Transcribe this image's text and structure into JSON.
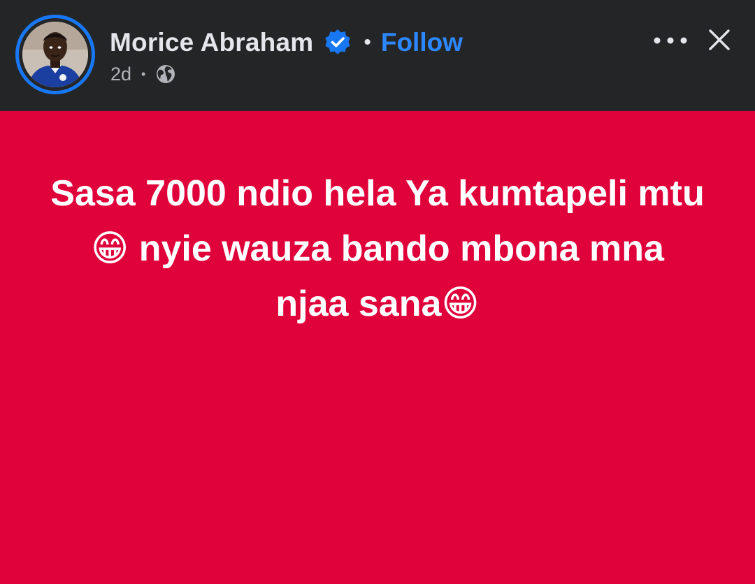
{
  "header": {
    "author_name": "Morice Abraham",
    "separator": "•",
    "follow_label": "Follow",
    "timestamp": "2d",
    "meta_separator": "•",
    "audience_icon": "globe-icon",
    "verified_icon": "verified-badge-icon",
    "more_icon": "more-options-icon",
    "close_icon": "close-icon"
  },
  "post": {
    "line1": "Sasa 7000 ndio hela Ya kumtapeli mtu",
    "line2": "😁 nyie wauza bando mbona mna",
    "line3": "njaa sana😁"
  },
  "colors": {
    "header_bg": "#242526",
    "post_bg": "#e0023a",
    "accent": "#2d88ff",
    "text_primary": "#e4e6eb",
    "text_secondary": "#b0b3b8"
  }
}
